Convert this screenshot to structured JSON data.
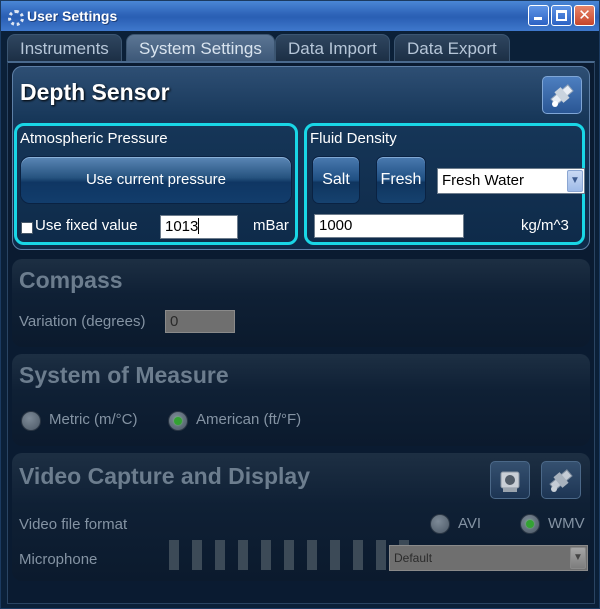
{
  "window": {
    "title": "User Settings",
    "icon": "gear-icon"
  },
  "tabs": [
    {
      "label": "Instruments",
      "active": false
    },
    {
      "label": "System Settings",
      "active": true
    },
    {
      "label": "Data Import",
      "active": false
    },
    {
      "label": "Data Export",
      "active": false
    }
  ],
  "depth_sensor": {
    "title": "Depth Sensor",
    "atmospheric": {
      "title": "Atmospheric Pressure",
      "use_current_label": "Use current pressure",
      "use_fixed_label": "Use fixed value",
      "use_fixed_checked": false,
      "value": "1013",
      "unit": "mBar"
    },
    "fluid": {
      "title": "Fluid Density",
      "salt_label": "Salt",
      "fresh_label": "Fresh",
      "selected": "Fresh Water",
      "value": "1000",
      "unit": "kg/m^3"
    }
  },
  "compass": {
    "title": "Compass",
    "variation_label": "Variation (degrees)",
    "variation_value": "0"
  },
  "measure": {
    "title": "System of Measure",
    "metric_label": "Metric (m/°C)",
    "american_label": "American (ft/°F)",
    "selected": "American (ft/°F)"
  },
  "video": {
    "title": "Video Capture and Display",
    "format_label": "Video file format",
    "avi_label": "AVI",
    "wmv_label": "WMV",
    "format_selected": "WMV",
    "microphone_label": "Microphone",
    "microphone_selected": "Default",
    "meter_segments": 11
  },
  "colors": {
    "accent_border": "#19d6e6",
    "title_bar": "#2e63b8"
  }
}
